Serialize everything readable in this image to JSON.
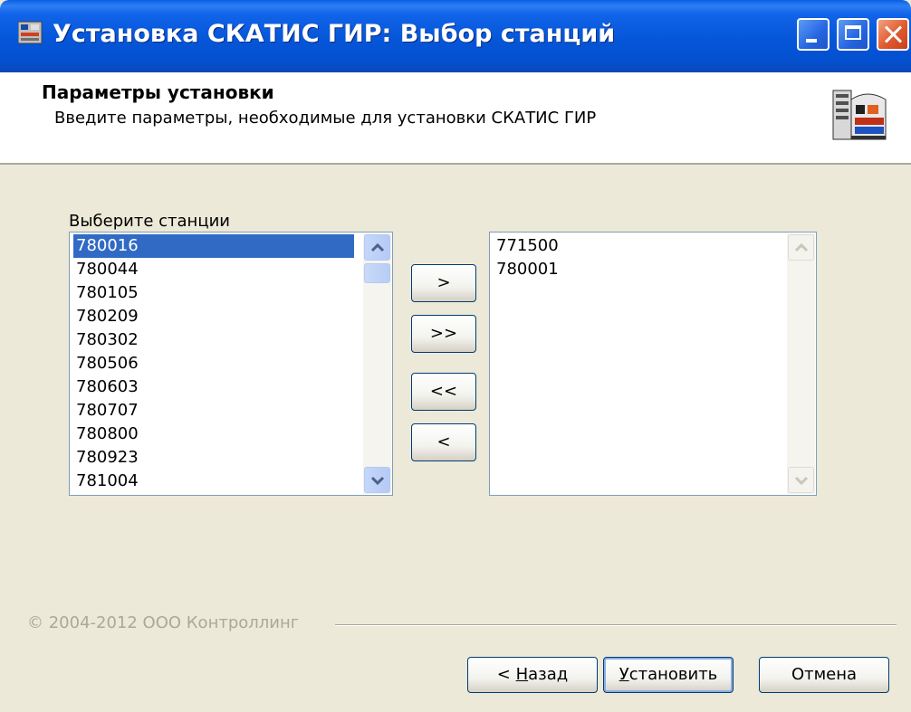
{
  "window": {
    "title": "Установка СКАТИС ГИР: Выбор станций"
  },
  "header": {
    "title": "Параметры установки",
    "subtitle": "Введите параметры, необходимые для установки СКАТИС ГИР"
  },
  "stations": {
    "label": "Выберите станции",
    "available": [
      "780016",
      "780044",
      "780105",
      "780209",
      "780302",
      "780506",
      "780603",
      "780707",
      "780800",
      "780923",
      "781004"
    ],
    "selected_index": 0,
    "chosen": [
      "771500",
      "780001"
    ]
  },
  "move_buttons": {
    "add": ">",
    "add_all": ">>",
    "remove_all": "<<",
    "remove": "<"
  },
  "footer": {
    "copyright": "© 2004-2012 ООО Контроллинг",
    "back_prefix": "< ",
    "back_hotkey": "Н",
    "back_rest": "азад",
    "install_hotkey": "У",
    "install_rest": "становить",
    "cancel": "Отмена"
  },
  "colors": {
    "titlebar": "#0554d8",
    "selection": "#316ac5",
    "dialog_bg": "#ece9d8"
  },
  "icons": {
    "app": "station-building-icon",
    "header": "station-building-icon"
  }
}
